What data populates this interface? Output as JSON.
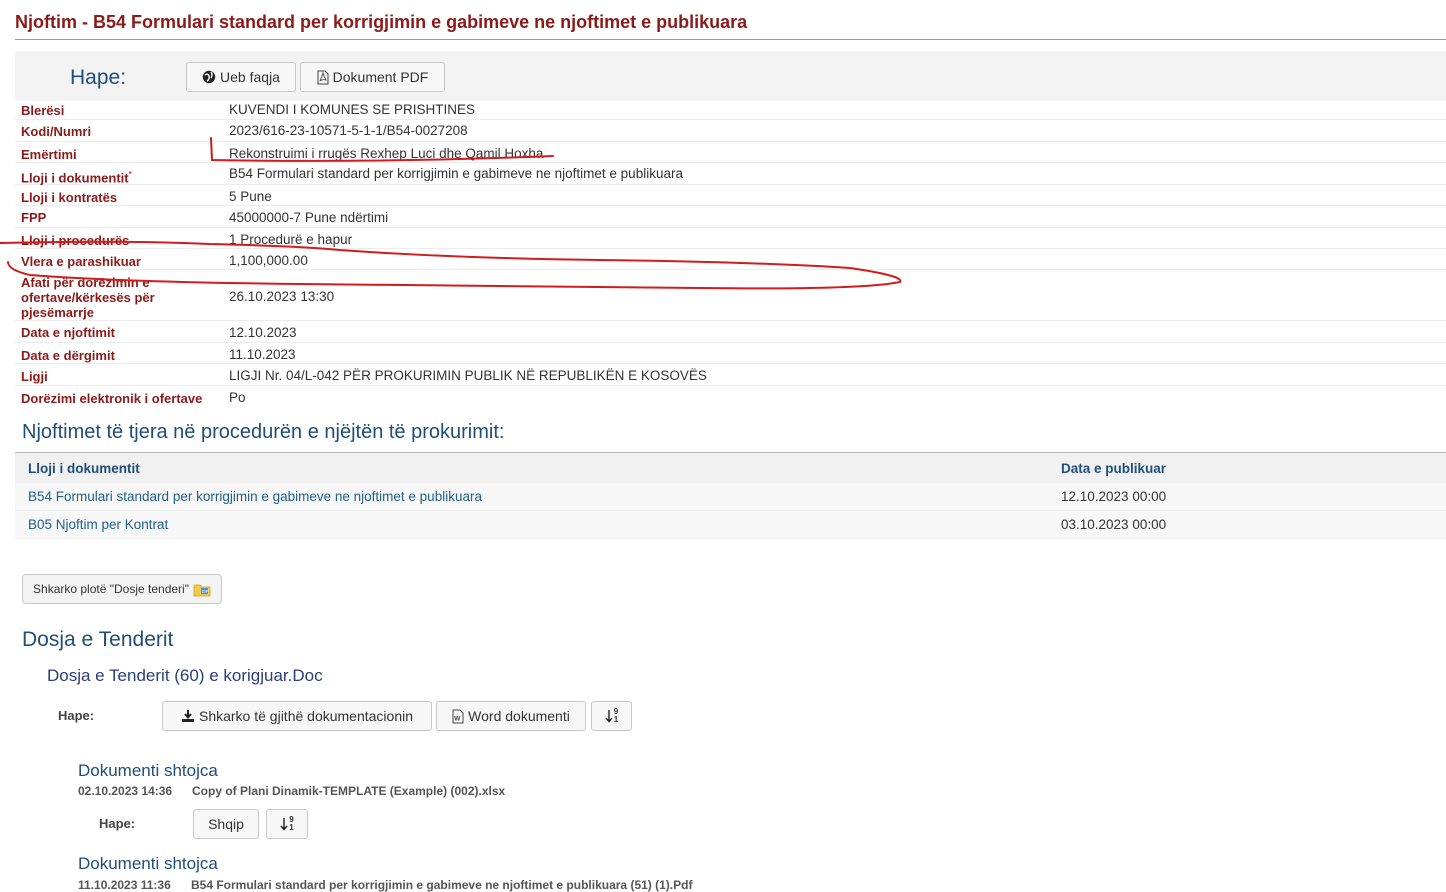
{
  "page": {
    "title": "Njoftim - B54 Formulari standard per korrigjimin e gabimeve ne njoftimet e publikuara"
  },
  "open_bar": {
    "label": "Hape:",
    "web_button": "Ueb faqja",
    "pdf_button": "Dokument PDF"
  },
  "details": [
    {
      "label": "Blerësi",
      "value": "KUVENDI I KOMUNES SE PRISHTINES"
    },
    {
      "label": "Kodi/Numri",
      "value": "2023/616-23-10571-5-1-1/B54-0027208"
    },
    {
      "label": "Emërtimi",
      "value": "Rekonstruimi i rrugës Rexhep Luci dhe Qamil Hoxha"
    },
    {
      "label": "Lloji i dokumentit",
      "value": "B54 Formulari standard per korrigjimin e gabimeve ne njoftimet e publikuara"
    },
    {
      "label": "Lloji i kontratës",
      "value": "5 Pune"
    },
    {
      "label": "FPP",
      "value": "45000000-7 Pune ndërtimi"
    },
    {
      "label": "Lloji i procedurës",
      "value": "1 Procedurë e hapur"
    },
    {
      "label": "Vlera e parashikuar",
      "value": "1,100,000.00"
    },
    {
      "label": "Afati për dorëzimin e ofertave/kërkesës për pjesëmarrje",
      "value": "26.10.2023 13:30"
    },
    {
      "label": "Data e njoftimit",
      "value": "12.10.2023"
    },
    {
      "label": "Data e dërgimit",
      "value": "11.10.2023"
    },
    {
      "label": "Ligji",
      "value": "LIGJI Nr. 04/L-042 PËR PROKURIMIN PUBLIK NË REPUBLIKËN E KOSOVËS"
    },
    {
      "label": "Dorëzimi elektronik i ofertave",
      "value": "Po"
    }
  ],
  "required_mark": "*",
  "other_notices": {
    "heading": "Njoftimet të tjera në procedurën e njëjtën të prokurimit:",
    "columns": [
      "Lloji i dokumentit",
      "Data e publikuar"
    ],
    "rows": [
      {
        "doc": "B54 Formulari standard per korrigjimin e gabimeve ne njoftimet e publikuara",
        "date": "12.10.2023 00:00"
      },
      {
        "doc": "B05 Njoftim per Kontrat",
        "date": "03.10.2023 00:00"
      }
    ]
  },
  "download_all_button": "Shkarko plotë \"Dosje tenderi\"",
  "tender_file": {
    "heading": "Dosja e Tenderit",
    "sub_heading": "Dosja e Tenderit (60) e korigjuar.Doc",
    "open_label": "Hape:",
    "download_button": "Shkarko të gjithë dokumentacionin",
    "word_button": "Word dokumenti",
    "sort_glyph_top": "9",
    "sort_glyph_bottom": "1"
  },
  "attachments": [
    {
      "heading": "Dokumenti shtojca",
      "datetime": "02.10.2023 14:36",
      "filename": "Copy of Plani Dinamik-TEMPLATE (Example) (002).xlsx",
      "open_label": "Hape:",
      "lang_button": "Shqip"
    },
    {
      "heading": "Dokumenti shtojca",
      "datetime": "11.10.2023 11:36",
      "filename": "B54 Formulari standard per korrigjimin e gabimeve ne njoftimet e publikuara (51) (1).Pdf"
    }
  ],
  "colors": {
    "label_red": "#8b1a1a",
    "heading_blue": "#1f4e79",
    "link_blue": "#1f5f8b",
    "annotation_red": "#d21b1b"
  },
  "icons": [
    "globe-icon",
    "pdf-icon",
    "download-icon",
    "word-icon",
    "sort-icon",
    "zip-icon"
  ]
}
